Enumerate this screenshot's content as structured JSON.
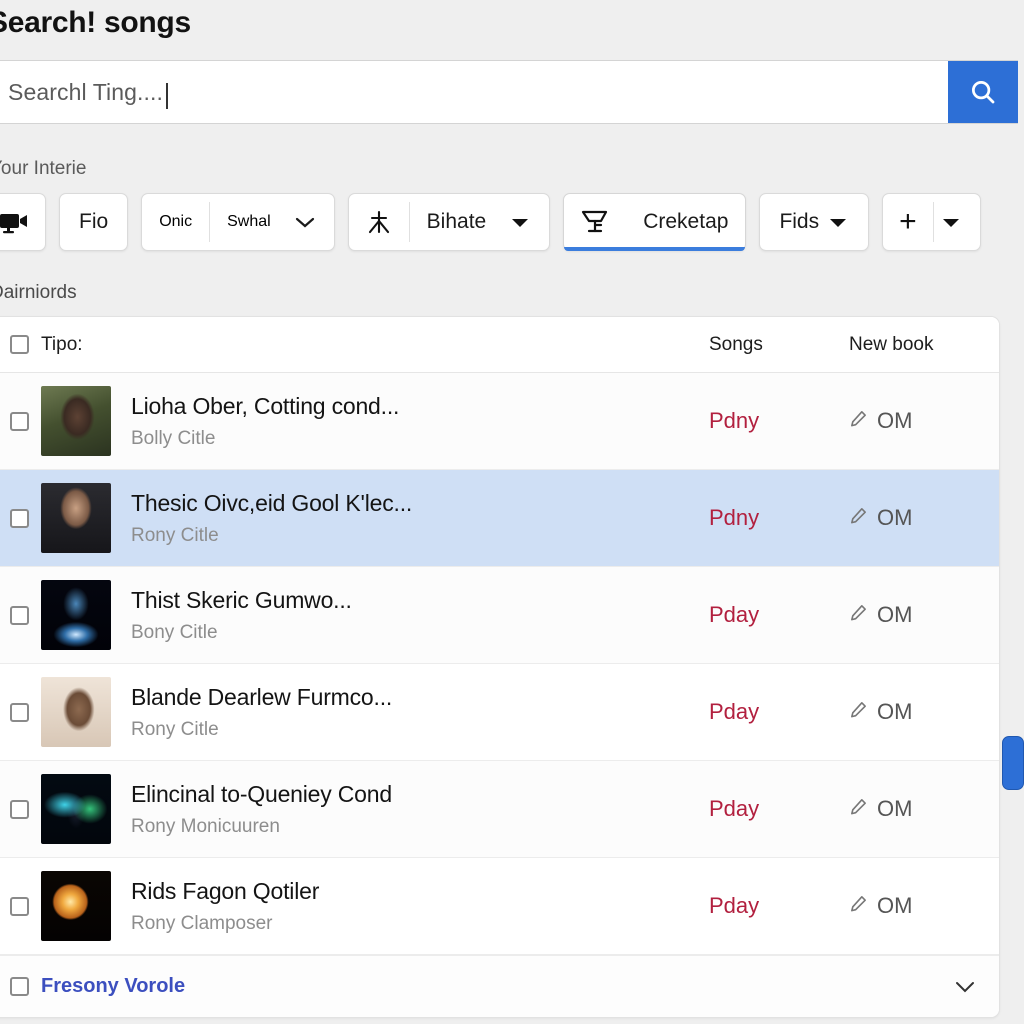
{
  "header": {
    "title": "Search! songs",
    "search_value": "Searchl Ting....",
    "search_icon": "search-icon"
  },
  "toolbar": {
    "interests_label": "Your Interie",
    "records_label": "Dairniords",
    "chips": [
      {
        "name": "video",
        "icon": "video-camera-icon",
        "label": ""
      },
      {
        "name": "fio",
        "label": "Fio"
      },
      {
        "name": "onic-swhal",
        "label_left": "Onic",
        "label_right": "Swhal",
        "caret": "chevron-down-icon"
      },
      {
        "name": "bihate",
        "icon": "share-nodes-icon",
        "label": "Bihate",
        "caret": "caret-down-icon"
      },
      {
        "name": "creketap",
        "icon": "shopping-cart-icon",
        "label": "Creketap",
        "active": true
      },
      {
        "name": "fids",
        "label": "Fids",
        "caret": "caret-down-icon"
      },
      {
        "name": "add",
        "label": "+",
        "caret": "caret-down-icon"
      }
    ]
  },
  "table": {
    "columns": {
      "select": "",
      "title": "Tipo:",
      "songs": "Songs",
      "new_book": "New book"
    },
    "rows": [
      {
        "title": "Lioha Ober, Cotting cond...",
        "subtitle": "Bolly Citle",
        "songs": "Pdny",
        "new_book": "OM",
        "thumb": "t1",
        "selected": false
      },
      {
        "title": "Thesic Oivc,eid Gool K'lec...",
        "subtitle": "Rony Citle",
        "songs": "Pdny",
        "new_book": "OM",
        "thumb": "t2",
        "selected": true
      },
      {
        "title": "Thist Skeric Gumwo...",
        "subtitle": "Bony Citle",
        "songs": "Pday",
        "new_book": "OM",
        "thumb": "t3",
        "selected": false
      },
      {
        "title": "Blande Dearlew Furmco...",
        "subtitle": "Rony Citle",
        "songs": "Pday",
        "new_book": "OM",
        "thumb": "t4",
        "selected": false
      },
      {
        "title": "Elincinal to-Queniey Cond",
        "subtitle": "Rony Monicuuren",
        "songs": "Pday",
        "new_book": "OM",
        "thumb": "t5",
        "selected": false
      },
      {
        "title": "Rids Fagon Qotiler",
        "subtitle": "Rony Clamposer",
        "songs": "Pday",
        "new_book": "OM",
        "thumb": "t6",
        "selected": false
      }
    ],
    "footer": {
      "label": "Fresony Vorole",
      "caret": "chevron-down-icon"
    }
  },
  "colors": {
    "accent_blue": "#2d6fd6",
    "songs_red": "#b2203f",
    "selected_row": "#cfdff5",
    "footer_link": "#3c4fbf",
    "page_bg": "#efefef"
  }
}
